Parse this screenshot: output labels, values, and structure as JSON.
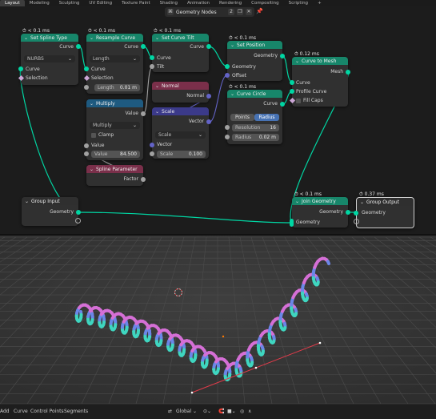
{
  "workspace_tabs": [
    "Layout",
    "Modeling",
    "Sculpting",
    "UV Editing",
    "Texture Paint",
    "Shading",
    "Animation",
    "Rendering",
    "Compositing",
    "Scripting"
  ],
  "add_tab": "+",
  "node_tree": {
    "name": "Geometry Nodes",
    "users": "2"
  },
  "nodes": {
    "set_spline_type": {
      "time": "< 0.1 ms",
      "title": "Set Spline Type",
      "out_curve": "Curve",
      "type_value": "NURBS",
      "in_curve": "Curve",
      "in_selection": "Selection"
    },
    "resample_curve": {
      "time": "< 0.1 ms",
      "title": "Resample Curve",
      "out_curve": "Curve",
      "mode": "Length",
      "in_curve": "Curve",
      "in_selection": "Selection",
      "length_label": "Length",
      "length_value": "0.01 m"
    },
    "set_curve_tilt": {
      "time": "< 0.1 ms",
      "title": "Set Curve Tilt",
      "out_curve": "Curve",
      "in_curve": "Curve",
      "in_tilt": "Tilt"
    },
    "multiply": {
      "title": "Multiply",
      "out_value": "Value",
      "operation": "Multiply",
      "clamp": "Clamp",
      "in_value": "Value",
      "value_label": "Value",
      "value": "84.500"
    },
    "spline_parameter": {
      "title": "Spline Parameter",
      "out_factor": "Factor"
    },
    "normal": {
      "title": "Normal",
      "out_normal": "Normal"
    },
    "scale": {
      "title": "Scale",
      "out_vector": "Vector",
      "mode": "Scale",
      "in_vector": "Vector",
      "scale_label": "Scale",
      "scale_value": "0.100"
    },
    "set_position": {
      "time": "< 0.1 ms",
      "title": "Set Position",
      "out_geometry": "Geometry",
      "in_geometry": "Geometry",
      "in_offset": "Offset"
    },
    "curve_circle": {
      "time": "< 0.1 ms",
      "title": "Curve Circle",
      "out_curve": "Curve",
      "mode_points": "Points",
      "mode_radius": "Radius",
      "resolution_label": "Resolution",
      "resolution_value": "16",
      "radius_label": "Radius",
      "radius_value": "0.02 m"
    },
    "curve_to_mesh": {
      "time": "0.12 ms",
      "title": "Curve to Mesh",
      "out_mesh": "Mesh",
      "in_curve": "Curve",
      "in_profile": "Profile Curve",
      "fill_caps": "Fill Caps"
    },
    "group_input": {
      "title": "Group Input",
      "out_geometry": "Geometry"
    },
    "join_geometry": {
      "time": "< 0.1 ms",
      "title": "Join Geometry",
      "out_geometry": "Geometry",
      "in_geometry": "Geometry"
    },
    "group_output": {
      "time": "0.37 ms",
      "title": "Group Output",
      "in_geometry": "Geometry"
    }
  },
  "viewport_header": {
    "menus": [
      "Add",
      "Curve",
      "Control Points",
      "Segments"
    ],
    "orientation": "Global"
  },
  "colors": {
    "geometry_socket": "#00d6a3",
    "geometry_header": "#17866a",
    "function_header": "#1e5a80",
    "vector_header": "#3b3a8a",
    "attribute_header": "#7a2f4a",
    "link_geometry": "#00d6a3",
    "link_float": "#a1a1a1",
    "link_vector": "#6363c7"
  },
  "icons": [
    "stopwatch-icon",
    "chevron-down-icon",
    "node-tree-icon",
    "pin-icon",
    "close-icon",
    "fake-user-icon",
    "cursor-icon",
    "proportional-icon",
    "snap-icon"
  ]
}
